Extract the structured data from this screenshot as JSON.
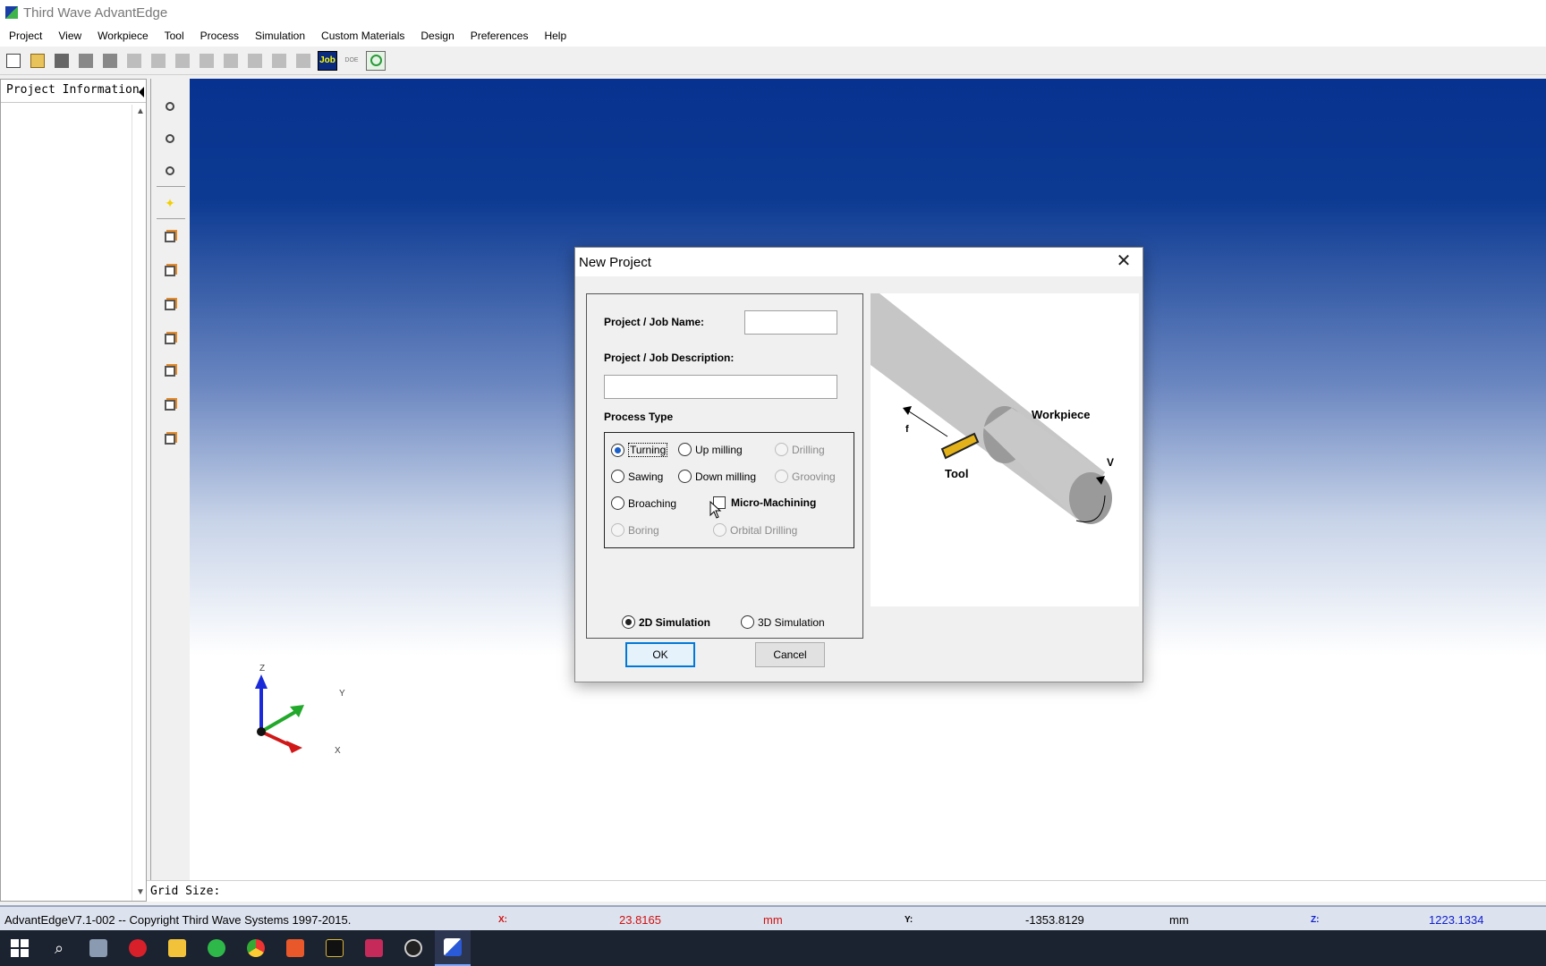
{
  "app": {
    "title": "Third Wave AdvantEdge"
  },
  "menu": [
    "Project",
    "View",
    "Workpiece",
    "Tool",
    "Process",
    "Simulation",
    "Custom Materials",
    "Design",
    "Preferences",
    "Help"
  ],
  "toolbar": {
    "job_label": "Job",
    "doe_label": "DOE"
  },
  "panel": {
    "title": "Project Information"
  },
  "grid": {
    "label": "Grid Size:"
  },
  "axes": {
    "z": "Z",
    "y": "Y",
    "x": "X"
  },
  "status": {
    "copyright": "AdvantEdgeV7.1-002 -- Copyright Third Wave Systems 1997-2015.",
    "x_label": "X:",
    "x_value": "23.8165",
    "x_unit": "mm",
    "y_label": "Y:",
    "y_value": "-1353.8129",
    "y_unit": "mm",
    "z_label": "Z:",
    "z_value": "1223.1334"
  },
  "dialog": {
    "title": "New Project",
    "name_label": "Project / Job Name:",
    "name_value": "",
    "desc_label": "Project / Job Description:",
    "desc_value": "",
    "process_type_label": "Process Type",
    "options": {
      "turning": "Turning",
      "up_milling": "Up milling",
      "drilling": "Drilling",
      "sawing": "Sawing",
      "down_milling": "Down milling",
      "grooving": "Grooving",
      "broaching": "Broaching",
      "micro_machining": "Micro-Machining",
      "boring": "Boring",
      "orbital_drilling": "Orbital Drilling"
    },
    "sim_2d": "2D Simulation",
    "sim_3d": "3D Simulation",
    "ok": "OK",
    "cancel": "Cancel",
    "preview": {
      "workpiece": "Workpiece",
      "tool": "Tool",
      "f": "f",
      "v": "V"
    }
  }
}
